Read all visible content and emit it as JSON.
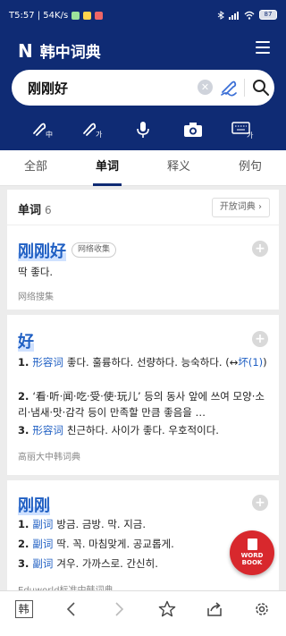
{
  "status_bar": {
    "time_speed": "T5:57 | 54K/s",
    "battery": "87"
  },
  "header": {
    "logo": "N",
    "title": "韩中词典"
  },
  "search": {
    "value": "刚刚好",
    "clear_icon": "clear-icon",
    "handwriting_icon": "handwriting-icon",
    "search_icon": "search-icon"
  },
  "tools": [
    {
      "name": "chinese-handwriting-icon"
    },
    {
      "name": "korean-handwriting-icon"
    },
    {
      "name": "microphone-icon"
    },
    {
      "name": "camera-icon"
    },
    {
      "name": "keyboard-icon"
    }
  ],
  "tabs": [
    {
      "label": "全部",
      "active": false
    },
    {
      "label": "单词",
      "active": true
    },
    {
      "label": "释义",
      "active": false
    },
    {
      "label": "例句",
      "active": false
    }
  ],
  "section": {
    "label": "单词",
    "count": "6",
    "open_dict": "开放词典 ›"
  },
  "entries": [
    {
      "headword": "刚刚好",
      "tag": "网络收集",
      "definition": "딱 좋다.",
      "source": "网络搜集"
    },
    {
      "headword": "好",
      "senses": [
        {
          "num": "1.",
          "pos": "形容词",
          "text": "좋다. 훌륭하다. 선량하다. 능숙하다. (↔",
          "link": "坏(1)",
          "tail": ")"
        },
        {
          "num": "2.",
          "pos": "",
          "text": "‘看·听·闻·吃·受·使·玩儿’ 등의 동사 앞에 쓰여 모양·소리·냄새·맛·감각 등이 만족할 만큼 좋음을 …"
        },
        {
          "num": "3.",
          "pos": "形容词",
          "text": "친근하다. 사이가 좋다. 우호적이다."
        }
      ],
      "source": "高丽大中韩词典"
    },
    {
      "headword": "刚刚",
      "senses": [
        {
          "num": "1.",
          "pos": "副词",
          "text": "방금. 금방. 막. 지금."
        },
        {
          "num": "2.",
          "pos": "副词",
          "text": "딱. 꼭. 마침맞게. 공교롭게."
        },
        {
          "num": "3.",
          "pos": "副词",
          "text": "겨우. 가까스로. 간신히."
        }
      ],
      "source": "Eduworld标准中韩词典"
    }
  ],
  "wordbook": {
    "line1": "WORD",
    "line2": "BOOK"
  },
  "bottom_bar": {
    "han": "韩",
    "icons": [
      "back-icon",
      "forward-icon",
      "star-icon",
      "share-icon",
      "settings-icon"
    ]
  },
  "colors": {
    "brand": "#0f2b74",
    "accent": "#1f5fc3",
    "wordbook": "#d8282d"
  }
}
